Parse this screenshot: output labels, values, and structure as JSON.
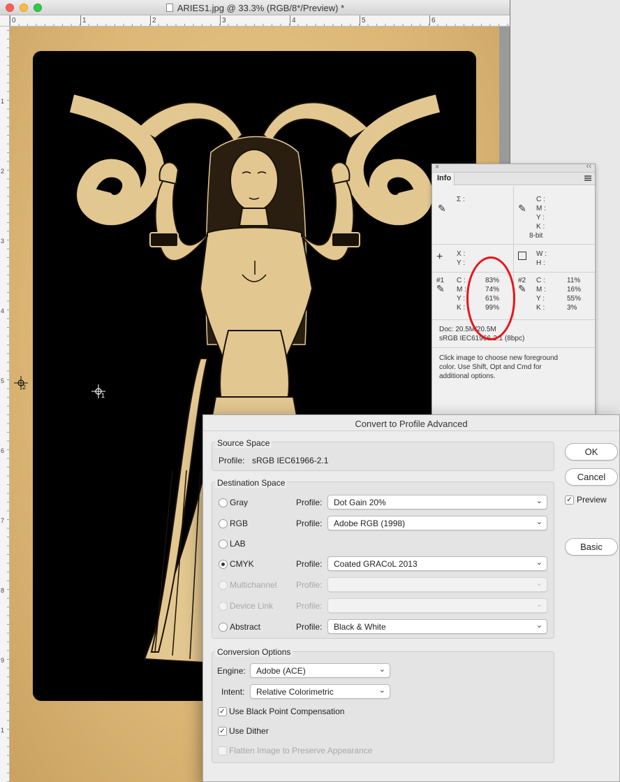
{
  "window": {
    "title": "ARIES1.jpg @ 33.3% (RGB/8*/Preview) *"
  },
  "ruler": {
    "top": [
      "0",
      "1",
      "2",
      "3",
      "4",
      "5",
      "6"
    ],
    "left": [
      "1",
      "2",
      "3",
      "4",
      "5",
      "6",
      "7",
      "8",
      "9",
      "1"
    ]
  },
  "canvas_markers": {
    "sampler1": "1",
    "sampler2": "2"
  },
  "info_panel": {
    "tab": "Info",
    "sigma": "Σ :",
    "cmyk_labels": {
      "c": "C :",
      "m": "M :",
      "y": "Y :",
      "k": "K :"
    },
    "bit_depth": "8-bit",
    "xy": {
      "x": "X :",
      "y": "Y :"
    },
    "wh": {
      "w": "W :",
      "h": "H :"
    },
    "sampler1": {
      "id": "#1",
      "c_label": "C :",
      "m_label": "M :",
      "y_label": "Y :",
      "k_label": "K :",
      "c": "83%",
      "m": "74%",
      "y": "61%",
      "k": "99%"
    },
    "sampler2": {
      "id": "#2",
      "c_label": "C :",
      "m_label": "M :",
      "y_label": "Y :",
      "k_label": "K :",
      "c": "11%",
      "m": "16%",
      "y": "55%",
      "k": "3%"
    },
    "doc_size": "Doc: 20.5M/20.5M",
    "profile": "sRGB IEC61966-2.1 (8bpc)",
    "hint": [
      "Click image to choose new foreground",
      "color.  Use Shift, Opt and Cmd for",
      "additional options."
    ]
  },
  "dialog": {
    "title": "Convert to Profile Advanced",
    "source": {
      "title": "Source Space",
      "profile_label": "Profile:",
      "profile_value": "sRGB IEC61966-2.1"
    },
    "destination": {
      "title": "Destination Space",
      "profile_label": "Profile:",
      "rows": [
        {
          "label": "Gray",
          "value": "Dot Gain 20%"
        },
        {
          "label": "RGB",
          "value": "Adobe RGB (1998)"
        },
        {
          "label": "LAB",
          "value": ""
        },
        {
          "label": "CMYK",
          "value": "Coated GRACoL 2013"
        },
        {
          "label": "Multichannel",
          "value": ""
        },
        {
          "label": "Device Link",
          "value": ""
        },
        {
          "label": "Abstract",
          "value": "Black & White"
        }
      ]
    },
    "conversion": {
      "title": "Conversion Options",
      "engine_label": "Engine:",
      "engine_value": "Adobe (ACE)",
      "intent_label": "Intent:",
      "intent_value": "Relative Colorimetric",
      "bpc": "Use Black Point Compensation",
      "dither": "Use Dither",
      "flatten": "Flatten Image to Preserve Appearance"
    },
    "buttons": {
      "ok": "OK",
      "cancel": "Cancel",
      "preview": "Preview",
      "basic": "Basic"
    }
  }
}
